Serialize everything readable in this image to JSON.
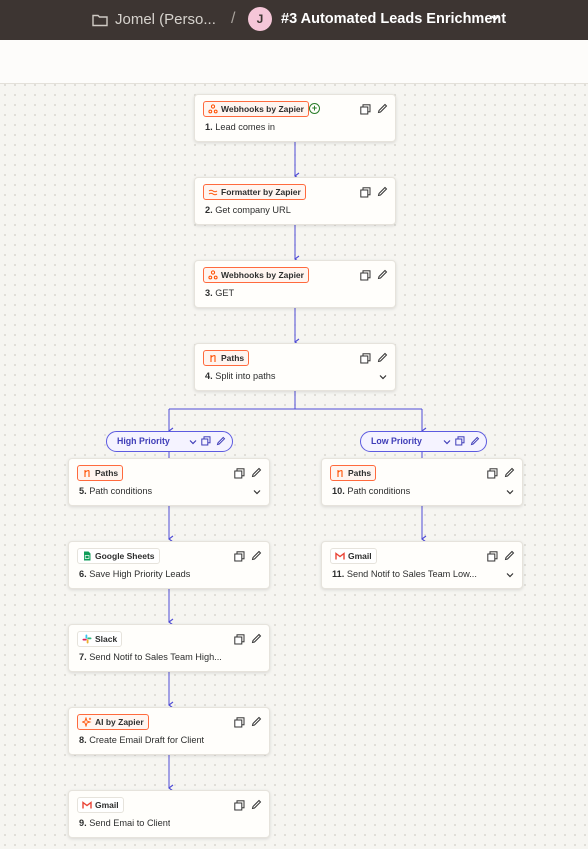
{
  "header": {
    "folder_name": "Jomel (Perso...",
    "separator": "/",
    "avatar_initial": "J",
    "zap_title": "#3 Automated Leads Enrichment"
  },
  "colors": {
    "topbar": "#3d3532",
    "connector": "#4d4ad6",
    "zapier_orange": "#ff6a3d"
  },
  "steps": [
    {
      "app": "Webhooks by Zapier",
      "number": "1.",
      "title": "Lead comes in",
      "icon": "webhook-icon"
    },
    {
      "app": "Formatter by Zapier",
      "number": "2.",
      "title": "Get company URL",
      "icon": "formatter-icon"
    },
    {
      "app": "Webhooks by Zapier",
      "number": "3.",
      "title": "GET",
      "icon": "webhook-icon"
    },
    {
      "app": "Paths",
      "number": "4.",
      "title": "Split into paths",
      "icon": "paths-icon"
    },
    {
      "app": "Paths",
      "number": "5.",
      "title": "Path conditions",
      "icon": "paths-icon"
    },
    {
      "app": "Google Sheets",
      "number": "6.",
      "title": "Save High Priority Leads",
      "icon": "google-sheets-icon"
    },
    {
      "app": "Slack",
      "number": "7.",
      "title": "Send Notif to Sales Team High...",
      "icon": "slack-icon"
    },
    {
      "app": "AI by Zapier",
      "number": "8.",
      "title": "Create Email Draft for Client",
      "icon": "ai-icon"
    },
    {
      "app": "Gmail",
      "number": "9.",
      "title": "Send Emai to Client",
      "icon": "gmail-icon"
    },
    {
      "app": "Paths",
      "number": "10.",
      "title": "Path conditions",
      "icon": "paths-icon"
    },
    {
      "app": "Gmail",
      "number": "11.",
      "title": "Send Notif to Sales Team Low...",
      "icon": "gmail-icon"
    }
  ],
  "paths": [
    {
      "label": "High Priority"
    },
    {
      "label": "Low Priority"
    }
  ]
}
